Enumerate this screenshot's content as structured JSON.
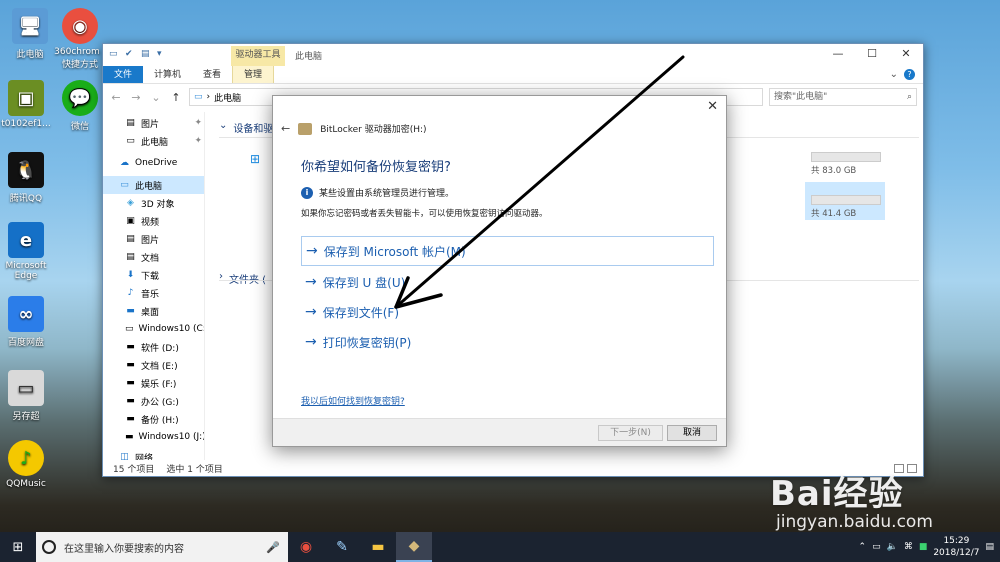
{
  "desktop_icons": [
    {
      "label": "此电脑",
      "glyph": "🖥",
      "color": "#5b9bd5"
    },
    {
      "label": "360chrom - 快捷方式",
      "glyph": "◉",
      "color": "#e94f3f"
    },
    {
      "label": "t0102ef1...",
      "glyph": "▣",
      "color": "#6b8e23"
    },
    {
      "label": "微信",
      "glyph": "💬",
      "color": "#1aad19"
    },
    {
      "label": "腾讯QQ",
      "glyph": "🐧",
      "color": "#111111"
    },
    {
      "label": "Microsoft Edge",
      "glyph": "e",
      "color": "#1570c7"
    },
    {
      "label": "百度网盘",
      "glyph": "∞",
      "color": "#2b7de9"
    },
    {
      "label": "另存超",
      "glyph": "▭",
      "color": "#d9d9d9"
    },
    {
      "label": "QQMusic",
      "glyph": "♪",
      "color": "#f4c800"
    }
  ],
  "explorer": {
    "context_tab": "驱动器工具",
    "title": "此电脑",
    "window_controls": [
      "—",
      "☐",
      "✕"
    ],
    "ribbon_tabs": [
      "文件",
      "计算机",
      "查看",
      "管理"
    ],
    "address": "此电脑",
    "search_placeholder": "搜索\"此电脑\"",
    "sidebar": [
      {
        "label": "图片",
        "icon": "▤",
        "pin": true
      },
      {
        "label": "此电脑",
        "icon": "▭",
        "pin": true
      },
      {
        "label": "OneDrive",
        "icon": "☁"
      },
      {
        "label": "此电脑",
        "icon": "▭",
        "selected": true
      },
      {
        "label": "3D 对象",
        "icon": "◈"
      },
      {
        "label": "视频",
        "icon": "▣"
      },
      {
        "label": "图片",
        "icon": "▤"
      },
      {
        "label": "文档",
        "icon": "▤"
      },
      {
        "label": "下载",
        "icon": "⬇"
      },
      {
        "label": "音乐",
        "icon": "♪"
      },
      {
        "label": "桌面",
        "icon": "▬"
      },
      {
        "label": "Windows10 (C:",
        "icon": "▭"
      },
      {
        "label": "软件 (D:)",
        "icon": "▬"
      },
      {
        "label": "文档 (E:)",
        "icon": "▬"
      },
      {
        "label": "娱乐 (F:)",
        "icon": "▬"
      },
      {
        "label": "办公 (G:)",
        "icon": "▬"
      },
      {
        "label": "备份 (H:)",
        "icon": "▬"
      },
      {
        "label": "Windows10 (J:)",
        "icon": "▬"
      },
      {
        "label": "网络",
        "icon": "◫"
      }
    ],
    "groups": [
      "设备和驱",
      "文件夹 ("
    ],
    "drive_sizes": [
      "共 83.0 GB",
      "共 41.4 GB"
    ],
    "status_items": "15 个项目",
    "status_selected": "选中 1 个项目"
  },
  "dialog": {
    "close": "✕",
    "header": "BitLocker 驱动器加密(H:)",
    "question": "你希望如何备份恢复密钥?",
    "info": "某些设置由系统管理员进行管理。",
    "note": "如果你忘记密码或者丢失智能卡，可以使用恢复密钥访问驱动器。",
    "options": [
      "保存到 Microsoft 帐户(M)",
      "保存到 U 盘(U)",
      "保存到文件(F)",
      "打印恢复密钥(P)"
    ],
    "help_link": "我以后如何找到恢复密钥?",
    "next_button": "下一步(N)",
    "cancel_button": "取消"
  },
  "taskbar": {
    "search_placeholder": "在这里输入你要搜索的内容",
    "time": "15:29",
    "date": "2018/12/7"
  },
  "watermark": {
    "brand": "Bai经验",
    "url": "jingyan.baidu.com"
  }
}
